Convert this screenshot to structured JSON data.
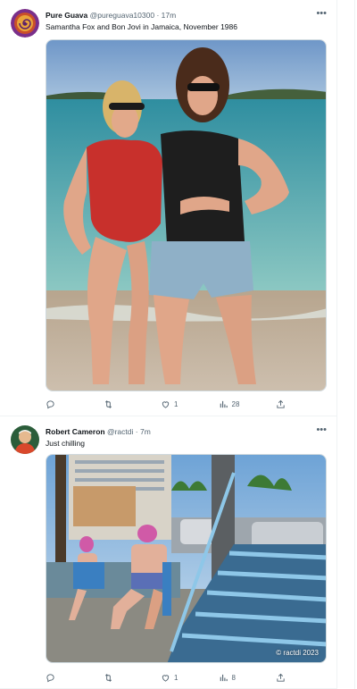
{
  "colors": {
    "text_primary": "#0f1419",
    "text_secondary": "#536471",
    "border": "#eff3f4"
  },
  "tweets": [
    {
      "author_name": "Pure Guava",
      "handle": "@pureguava10300",
      "separator": "·",
      "time": "17m",
      "text": "Samantha Fox and Bon Jovi in Jamaica, November 1986",
      "media_icon": "photo-beach",
      "stats": {
        "replies": "",
        "retweets": "",
        "likes": "1",
        "views": "28"
      }
    },
    {
      "author_name": "Robert Cameron",
      "handle": "@ractdi",
      "separator": "·",
      "time": "7m",
      "text": "Just chilling",
      "media_icon": "photo-street",
      "media_watermark": "© ractdi 2023",
      "stats": {
        "replies": "",
        "retweets": "",
        "likes": "1",
        "views": "8"
      }
    }
  ],
  "icons": {
    "more": "more-icon",
    "reply": "reply-icon",
    "retweet": "retweet-icon",
    "like": "like-icon",
    "views": "views-icon",
    "share": "share-icon"
  }
}
